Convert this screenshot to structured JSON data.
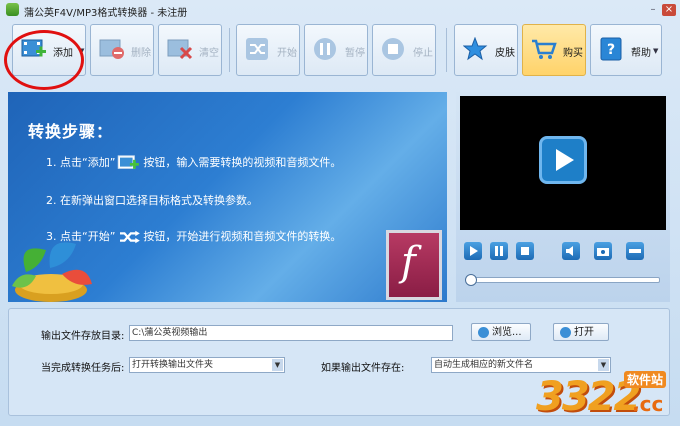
{
  "window": {
    "title": "蒲公英F4V/MP3格式转换器 - 未注册",
    "min": "–",
    "close": "×"
  },
  "toolbar": {
    "add": "添加",
    "delete": "删除",
    "clear": "清空",
    "start": "开始",
    "pause": "暂停",
    "stop": "停止",
    "skin": "皮肤",
    "buy": "购买",
    "help": "帮助"
  },
  "steps": {
    "title": "转换步骤：",
    "s1a": "1. 点击“添加”",
    "s1b": "按钮，输入需要转换的视频和音频文件。",
    "s2": "2. 在新弹出窗口选择目标格式及转换参数。",
    "s3a": "3. 点击“开始”",
    "s3b": "按钮，开始进行视频和音频文件的转换。"
  },
  "output": {
    "dir_label": "输出文件存放目录:",
    "dir_value": "C:\\蒲公英视频输出",
    "browse": "浏览...",
    "open": "打开",
    "after_label": "当完成转换任务后:",
    "after_value": "打开转换输出文件夹",
    "exists_label": "如果输出文件存在:",
    "exists_value": "自动生成相应的新文件名"
  },
  "watermark": {
    "number": "3322",
    "site": "软件站",
    "domain": ".cc"
  },
  "colors": {
    "accent": "#1e7fc8",
    "highlight": "#e01010"
  }
}
